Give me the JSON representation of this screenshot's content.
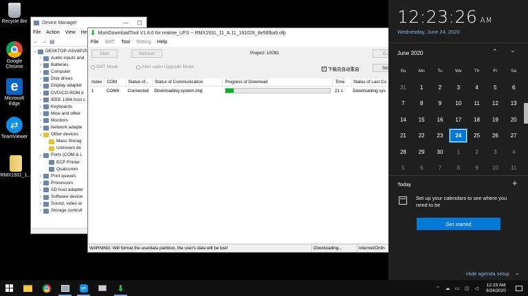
{
  "desktop": {
    "icons": [
      {
        "label": "Recycle Bin"
      },
      {
        "label": "Google Chrome"
      },
      {
        "label": "Microsoft Edge"
      },
      {
        "label": "TeamViewer"
      },
      {
        "label": "RMX1931_1..."
      }
    ]
  },
  "device_manager": {
    "title": "Device Manager",
    "menu": [
      "File",
      "Action",
      "View",
      "He"
    ],
    "tree": [
      {
        "label": "DESKTOP-ASV8P2N",
        "arrow": "⌄",
        "indent": 0,
        "warn": false
      },
      {
        "label": "Audio inputs and",
        "arrow": "›",
        "indent": 1,
        "warn": false
      },
      {
        "label": "Batteries",
        "arrow": "›",
        "indent": 1,
        "warn": false
      },
      {
        "label": "Computer",
        "arrow": "›",
        "indent": 1,
        "warn": false
      },
      {
        "label": "Disk drives",
        "arrow": "›",
        "indent": 1,
        "warn": false
      },
      {
        "label": "Display adapter",
        "arrow": "›",
        "indent": 1,
        "warn": false
      },
      {
        "label": "DVD/CD-ROM d",
        "arrow": "›",
        "indent": 1,
        "warn": false
      },
      {
        "label": "IEEE 1394 host c",
        "arrow": "›",
        "indent": 1,
        "warn": false
      },
      {
        "label": "Keyboards",
        "arrow": "›",
        "indent": 1,
        "warn": false
      },
      {
        "label": "Mice and other",
        "arrow": "›",
        "indent": 1,
        "warn": false
      },
      {
        "label": "Monitors",
        "arrow": "›",
        "indent": 1,
        "warn": false
      },
      {
        "label": "Network adapte",
        "arrow": "›",
        "indent": 1,
        "warn": false
      },
      {
        "label": "Other devices",
        "arrow": "⌄",
        "indent": 1,
        "warn": true
      },
      {
        "label": "Mass Storag",
        "arrow": "",
        "indent": 2,
        "warn": true
      },
      {
        "label": "Unknown de",
        "arrow": "",
        "indent": 2,
        "warn": true
      },
      {
        "label": "Ports (COM & L",
        "arrow": "⌄",
        "indent": 1,
        "warn": false
      },
      {
        "label": "ECP Printer",
        "arrow": "",
        "indent": 2,
        "warn": false
      },
      {
        "label": "Qualcomm",
        "arrow": "",
        "indent": 2,
        "warn": false
      },
      {
        "label": "Print queues",
        "arrow": "›",
        "indent": 1,
        "warn": false
      },
      {
        "label": "Processors",
        "arrow": "›",
        "indent": 1,
        "warn": false
      },
      {
        "label": "SD host adapter",
        "arrow": "›",
        "indent": 1,
        "warn": false
      },
      {
        "label": "Software device",
        "arrow": "›",
        "indent": 1,
        "warn": false
      },
      {
        "label": "Sound, video ar",
        "arrow": "›",
        "indent": 1,
        "warn": false
      },
      {
        "label": "Storage controll",
        "arrow": "›",
        "indent": 1,
        "warn": false
      }
    ]
  },
  "msm": {
    "title": "MsmDownloadTool V1.8.6 for realme_UFS -- RMX1931_11_A.11_191028_8e56fba9.ofp",
    "menu": [
      "File",
      "SMT",
      "Tool",
      "Setting",
      "Help"
    ],
    "start_label": "Start",
    "refresh_label": "Refresh",
    "project_label": "Project: 19781",
    "exit_label": "Ex",
    "smt_mode_label": "SMT Mode",
    "aftersales_label": "After-sales Upgrade Mode",
    "auto_reboot_label": "下载完自动重启",
    "auto_reboot_checked": true,
    "stop_label": "Sto",
    "columns": [
      "Index",
      "COM",
      "Status of...",
      "Status of Communication",
      "Progress of Download",
      "Time",
      "Status of Last Co"
    ],
    "rows": [
      {
        "index": "1",
        "com": "COM4",
        "status": "Connected",
        "comm": "Downloading system.img",
        "progress": 0.08,
        "time": "21 s",
        "last": "Downloading sys"
      }
    ],
    "status_bar": {
      "warning": "WARNING: Will format the userdata partition, the user's data will be lost!",
      "state": "Downloading...",
      "net": "Internet/Onlin"
    }
  },
  "flyout": {
    "time": "12:23:26",
    "ampm": "AM",
    "date": "Wednesday, June 24, 2020",
    "month": "June 2020",
    "prev_icon": "chevron-up-icon",
    "next_icon": "chevron-down-icon",
    "weekdays": [
      "Su",
      "Mo",
      "Tu",
      "We",
      "Th",
      "Fr",
      "Sa"
    ],
    "weeks": [
      [
        "31",
        "1",
        "2",
        "3",
        "4",
        "5",
        "6"
      ],
      [
        "7",
        "8",
        "9",
        "10",
        "11",
        "12",
        "13"
      ],
      [
        "14",
        "15",
        "16",
        "17",
        "18",
        "19",
        "20"
      ],
      [
        "21",
        "22",
        "23",
        "24",
        "25",
        "26",
        "27"
      ],
      [
        "28",
        "29",
        "30",
        "1",
        "2",
        "3",
        "4"
      ],
      [
        "5",
        "6",
        "7",
        "8",
        "9",
        "10",
        "11"
      ]
    ],
    "today": "24",
    "agenda_title": "Today",
    "agenda_message": "Set up your calendars to see where you need to be",
    "get_started_label": "Get started",
    "hide_agenda_label": "Hide agenda setup",
    "accent_color": "#0078d7"
  },
  "taskbar": {
    "apps": [
      "windows-logo-icon",
      "search-icon",
      "file-explorer-icon",
      "chrome-icon",
      "device-manager-icon",
      "teamviewer-icon",
      "drive-icon",
      "download-tool-icon"
    ],
    "time": "12:23 AM",
    "date": "6/24/2020"
  }
}
